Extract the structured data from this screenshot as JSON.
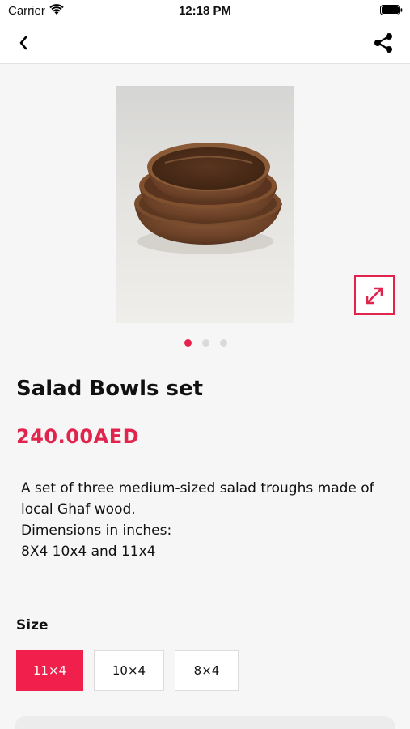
{
  "status_bar": {
    "carrier": "Carrier",
    "time": "12:18 PM",
    "icons": [
      "wifi-icon",
      "battery-icon"
    ]
  },
  "nav": {
    "back_icon": "chevron-left-icon",
    "share_icon": "share-icon"
  },
  "product": {
    "image_icon": "wooden-bowls-photo",
    "expand_icon": "expand-arrows-icon",
    "pager": {
      "total": 3,
      "active": 1
    },
    "title": "Salad Bowls set",
    "price": "240.00AED",
    "description_lines": [
      "A set of three medium-sized salad troughs made of",
      "local Ghaf wood.",
      "Dimensions in inches:",
      "8X4 10x4 and 11x4"
    ]
  },
  "size": {
    "label": "Size",
    "selected": "11×4",
    "options": [
      "11×4",
      "10×4",
      "8×4"
    ]
  },
  "colors": {
    "accent": "#e0244d",
    "selected_fill": "#f01f4b",
    "background": "#f6f6f6"
  }
}
